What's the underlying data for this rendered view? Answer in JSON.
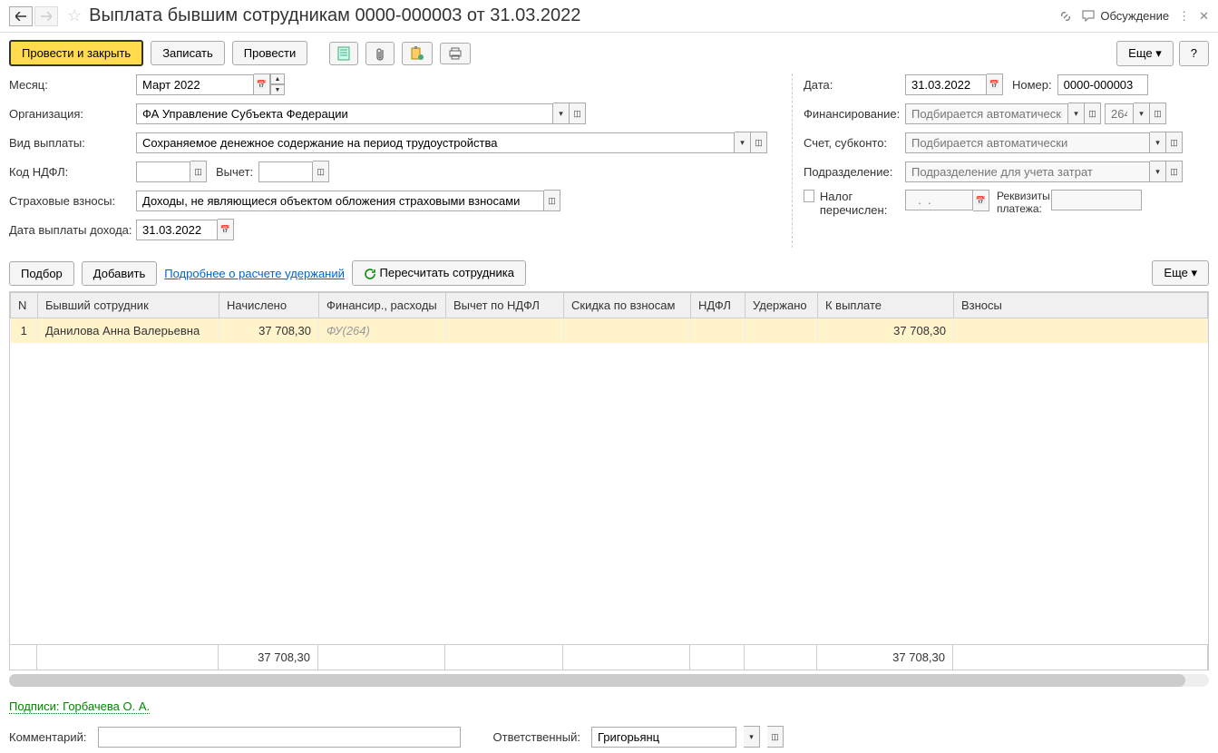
{
  "header": {
    "title": "Выплата бывшим сотрудникам 0000-000003 от 31.03.2022",
    "discuss": "Обсуждение"
  },
  "toolbar": {
    "post_close": "Провести и закрыть",
    "save": "Записать",
    "post": "Провести",
    "more": "Еще",
    "help": "?"
  },
  "form": {
    "month_label": "Месяц:",
    "month_value": "Март 2022",
    "org_label": "Организация:",
    "org_value": "ФА Управление Субъекта Федерации",
    "paytype_label": "Вид выплаты:",
    "paytype_value": "Сохраняемое денежное содержание на период трудоустройства",
    "ndfl_code_label": "Код НДФЛ:",
    "ndfl_code_value": "",
    "deduction_label": "Вычет:",
    "deduction_value": "",
    "insurance_label": "Страховые взносы:",
    "insurance_value": "Доходы, не являющиеся объектом обложения страховыми взносами",
    "paydate_label": "Дата выплаты дохода:",
    "paydate_value": "31.03.2022",
    "date_label": "Дата:",
    "date_value": "31.03.2022",
    "number_label": "Номер:",
    "number_value": "0000-000003",
    "financing_label": "Финансирование:",
    "financing_placeholder": "Подбирается автоматически",
    "financing_code": "264",
    "account_label": "Счет, субконто:",
    "account_placeholder": "Подбирается автоматически",
    "dept_label": "Подразделение:",
    "dept_placeholder": "Подразделение для учета затрат",
    "tax_paid_label": "Налог перечислен:",
    "tax_date_placeholder": "  .  .    ",
    "requisites_label": "Реквизиты платежа:"
  },
  "subtoolbar": {
    "select": "Подбор",
    "add": "Добавить",
    "details": "Подробнее о расчете удержаний",
    "recalc": "Пересчитать сотрудника",
    "more": "Еще"
  },
  "table": {
    "columns": {
      "n": "N",
      "employee": "Бывший сотрудник",
      "accrued": "Начислено",
      "financing": "Финансир., расходы",
      "deduction": "Вычет по НДФЛ",
      "discount": "Скидка по взносам",
      "ndfl": "НДФЛ",
      "withheld": "Удержано",
      "topay": "К выплате",
      "contributions": "Взносы"
    },
    "rows": [
      {
        "n": "1",
        "employee": "Данилова Анна Валерьевна",
        "accrued": "37 708,30",
        "financing": "ФУ(264)",
        "deduction": "",
        "discount": "",
        "ndfl": "",
        "withheld": "",
        "topay": "37 708,30",
        "contributions": ""
      }
    ],
    "totals": {
      "accrued": "37 708,30",
      "topay": "37 708,30"
    }
  },
  "signatures": {
    "text": "Подписи: Горбачева О. А."
  },
  "bottom": {
    "comment_label": "Комментарий:",
    "comment_value": "",
    "responsible_label": "Ответственный:",
    "responsible_value": "Григорьянц"
  }
}
